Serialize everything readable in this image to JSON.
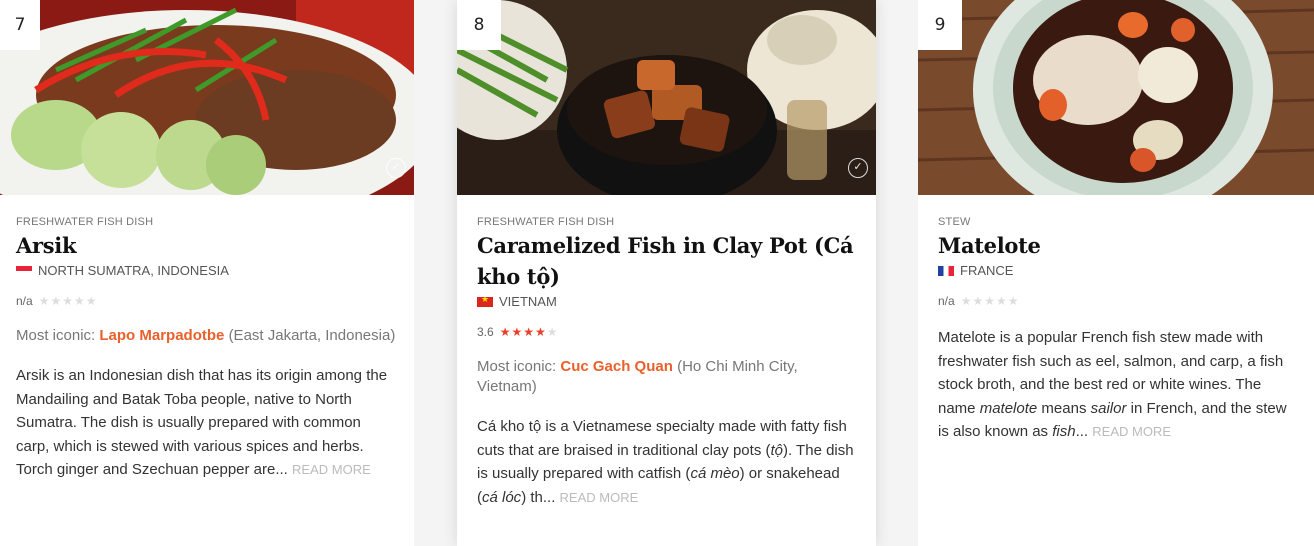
{
  "cards": [
    {
      "rank": "7",
      "category": "FRESHWATER FISH DISH",
      "name": "Arsik",
      "origin": "NORTH SUMATRA, INDONESIA",
      "rating_text": "n/a",
      "rating_value": 0,
      "iconic_label": "Most iconic:",
      "iconic_place": "Lapo Marpadotbe",
      "iconic_location": "(East Jakarta, Indonesia)",
      "description": "Arsik is an Indonesian dish that has its origin among the Mandailing and Batak Toba people, native to North Sumatra. The dish is usually prepared with common carp, which is stewed with various spices and herbs. Torch ginger and Szechuan pepper are...",
      "read_more": "READ MORE",
      "flag": "flag-indonesia-icon"
    },
    {
      "rank": "8",
      "category": "FRESHWATER FISH DISH",
      "name": "Caramelized Fish in Clay Pot (Cá kho tộ)",
      "origin": "VIETNAM",
      "rating_text": "3.6",
      "rating_value": 3.6,
      "iconic_label": "Most iconic:",
      "iconic_place": "Cuc Gach Quan",
      "iconic_location": "(Ho Chi Minh City, Vietnam)",
      "description_parts": [
        "Cá kho tộ is a Vietnamese specialty made with fatty fish cuts that are braised in traditional clay pots (",
        "tộ",
        "). The dish is usually prepared with catfish (",
        "cá mèo",
        ") or snakehead (",
        "cá lóc",
        ") th..."
      ],
      "read_more": "READ MORE",
      "flag": "flag-vietnam-icon"
    },
    {
      "rank": "9",
      "category": "STEW",
      "name": "Matelote",
      "origin": "FRANCE",
      "rating_text": "n/a",
      "rating_value": 0,
      "description_parts": [
        "Matelote is a popular French fish stew made with freshwater fish such as eel, salmon, and carp, a fish stock broth, and the best red or white wines. The name ",
        "matelote",
        " means ",
        "sailor",
        " in French, and the stew is also known as ",
        "fish",
        "..."
      ],
      "read_more": "READ MORE",
      "flag": "flag-france-icon"
    }
  ],
  "colors": {
    "accent": "#e8612c",
    "star_on": "#e8402a",
    "star_off": "#dddddd"
  }
}
